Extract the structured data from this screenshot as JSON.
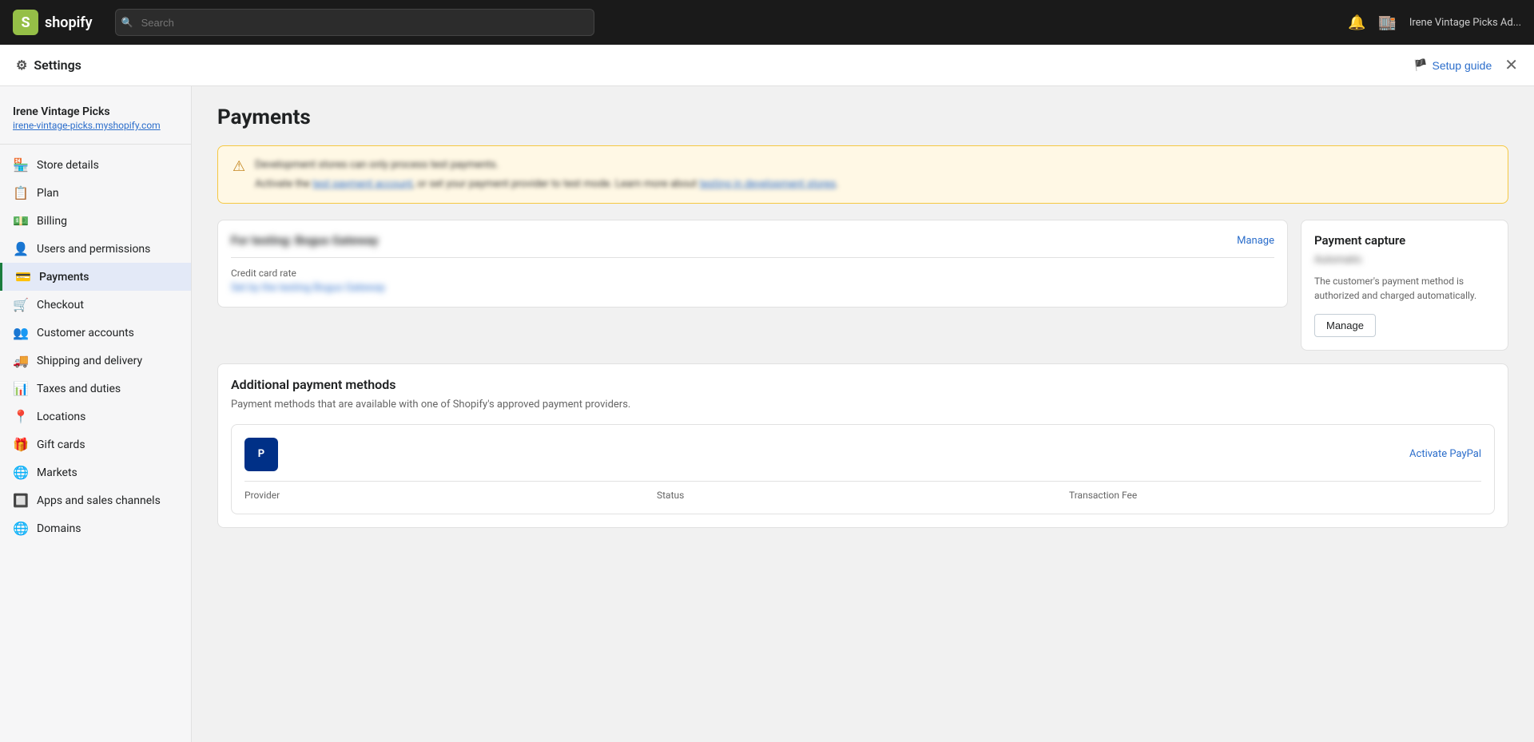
{
  "topbar": {
    "logo_initial": "S",
    "logo_name": "shopify",
    "search_placeholder": "Search",
    "user_name": "Irene Vintage Picks Ad..."
  },
  "settings_bar": {
    "title": "Settings",
    "title_icon": "⚙",
    "setup_guide_label": "Setup guide",
    "close_label": "✕"
  },
  "sidebar": {
    "store_name": "Irene Vintage Picks",
    "store_url": "irene-vintage-picks.myshopify.com",
    "nav_items": [
      {
        "id": "store-details",
        "label": "Store details",
        "icon": "🏪"
      },
      {
        "id": "plan",
        "label": "Plan",
        "icon": "📋"
      },
      {
        "id": "billing",
        "label": "Billing",
        "icon": "💵"
      },
      {
        "id": "users-permissions",
        "label": "Users and permissions",
        "icon": "👤"
      },
      {
        "id": "payments",
        "label": "Payments",
        "icon": "💳",
        "active": true
      },
      {
        "id": "checkout",
        "label": "Checkout",
        "icon": "🛒"
      },
      {
        "id": "customer-accounts",
        "label": "Customer accounts",
        "icon": "👥"
      },
      {
        "id": "shipping-delivery",
        "label": "Shipping and delivery",
        "icon": "🚚"
      },
      {
        "id": "taxes-duties",
        "label": "Taxes and duties",
        "icon": "📊"
      },
      {
        "id": "locations",
        "label": "Locations",
        "icon": "📍"
      },
      {
        "id": "gift-cards",
        "label": "Gift cards",
        "icon": "🎁"
      },
      {
        "id": "markets",
        "label": "Markets",
        "icon": "🌐"
      },
      {
        "id": "apps-sales-channels",
        "label": "Apps and sales channels",
        "icon": "🔲"
      },
      {
        "id": "domains",
        "label": "Domains",
        "icon": "🌐"
      }
    ]
  },
  "content": {
    "page_title": "Payments",
    "warning": {
      "icon": "⚠",
      "text_line1": "Development stores can only process test payments.",
      "text_line2_blurred": "Activate the test payment account, or set your payment provider to test mode. Learn more about testing in development stores."
    },
    "gateway_card": {
      "title_blurred": "For testing: Bogus Gateway",
      "manage_label": "Manage",
      "field_label": "Credit card rate",
      "field_value_blurred": "Set by the testing Bogus Gateway"
    },
    "payment_capture_card": {
      "title": "Payment capture",
      "subtitle_blurred": "Automatic",
      "description": "The customer's payment method is authorized and charged automatically.",
      "manage_label": "Manage"
    },
    "additional_methods": {
      "section_title": "Additional payment methods",
      "section_desc": "Payment methods that are available with one of Shopify's approved payment providers.",
      "provider": {
        "logo_text": "PP",
        "activate_label": "Activate PayPal",
        "headers": [
          "Provider",
          "Status",
          "Transaction Fee"
        ]
      }
    }
  }
}
